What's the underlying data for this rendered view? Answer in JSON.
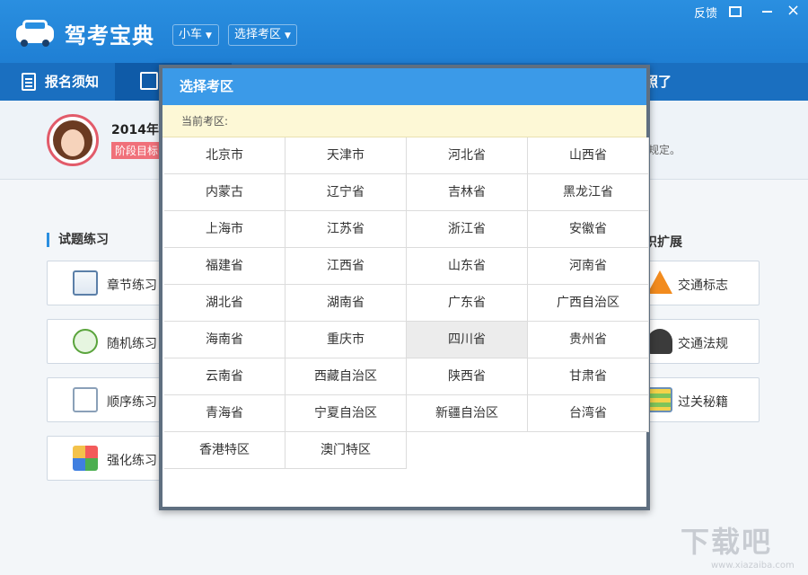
{
  "header": {
    "app_title": "驾考宝典",
    "car_type": "小车",
    "select_area_label": "选择考区",
    "feedback": "反馈",
    "close_symbol": "×"
  },
  "tabs": {
    "notice": "报名须知",
    "photo_partial": "照了"
  },
  "profile": {
    "title_partial": "2014年驾",
    "tag_partial": "阶段目标",
    "note_partial": "规定。"
  },
  "sections": {
    "practice": "试题练习",
    "knowledge_partial": "识扩展"
  },
  "practice_buttons": [
    {
      "label": "章节练习",
      "icon": "chapter-icon"
    },
    {
      "label": "随机练习",
      "icon": "random-icon"
    },
    {
      "label": "顺序练习",
      "icon": "order-icon"
    },
    {
      "label": "强化练习",
      "icon": "strengthen-icon"
    }
  ],
  "knowledge_buttons": [
    {
      "label": "交通标志",
      "icon": "traffic-cone-icon"
    },
    {
      "label": "交通法规",
      "icon": "police-icon"
    },
    {
      "label": "过关秘籍",
      "icon": "checklist-icon"
    }
  ],
  "modal": {
    "title": "选择考区",
    "current_label": "当前考区:",
    "hovered": "四川省",
    "regions": [
      "北京市",
      "天津市",
      "河北省",
      "山西省",
      "内蒙古",
      "辽宁省",
      "吉林省",
      "黑龙江省",
      "上海市",
      "江苏省",
      "浙江省",
      "安徽省",
      "福建省",
      "江西省",
      "山东省",
      "河南省",
      "湖北省",
      "湖南省",
      "广东省",
      "广西自治区",
      "海南省",
      "重庆市",
      "四川省",
      "贵州省",
      "云南省",
      "西藏自治区",
      "陕西省",
      "甘肃省",
      "青海省",
      "宁夏自治区",
      "新疆自治区",
      "台湾省",
      "香港特区",
      "澳门特区"
    ]
  },
  "watermark": {
    "text": "下载吧",
    "url": "www.xiazaiba.com"
  },
  "colors": {
    "header": "#2a8fe0",
    "tabbar": "#1a6fc0",
    "modal_header": "#3b9ae8",
    "current_bar": "#fdf8d6"
  }
}
